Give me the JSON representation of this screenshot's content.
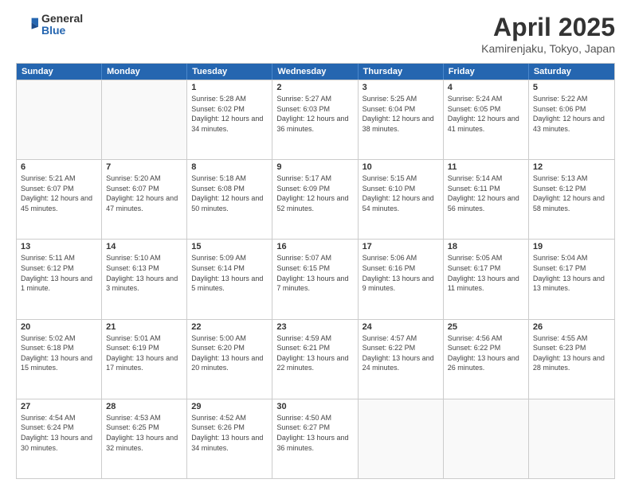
{
  "header": {
    "logo": {
      "general": "General",
      "blue": "Blue"
    },
    "title": "April 2025",
    "location": "Kamirenjaku, Tokyo, Japan"
  },
  "calendar": {
    "days_of_week": [
      "Sunday",
      "Monday",
      "Tuesday",
      "Wednesday",
      "Thursday",
      "Friday",
      "Saturday"
    ],
    "weeks": [
      [
        {
          "day": "",
          "empty": true
        },
        {
          "day": "",
          "empty": true
        },
        {
          "day": "1",
          "sunrise": "5:28 AM",
          "sunset": "6:02 PM",
          "daylight": "12 hours and 34 minutes."
        },
        {
          "day": "2",
          "sunrise": "5:27 AM",
          "sunset": "6:03 PM",
          "daylight": "12 hours and 36 minutes."
        },
        {
          "day": "3",
          "sunrise": "5:25 AM",
          "sunset": "6:04 PM",
          "daylight": "12 hours and 38 minutes."
        },
        {
          "day": "4",
          "sunrise": "5:24 AM",
          "sunset": "6:05 PM",
          "daylight": "12 hours and 41 minutes."
        },
        {
          "day": "5",
          "sunrise": "5:22 AM",
          "sunset": "6:06 PM",
          "daylight": "12 hours and 43 minutes."
        }
      ],
      [
        {
          "day": "6",
          "sunrise": "5:21 AM",
          "sunset": "6:07 PM",
          "daylight": "12 hours and 45 minutes."
        },
        {
          "day": "7",
          "sunrise": "5:20 AM",
          "sunset": "6:07 PM",
          "daylight": "12 hours and 47 minutes."
        },
        {
          "day": "8",
          "sunrise": "5:18 AM",
          "sunset": "6:08 PM",
          "daylight": "12 hours and 50 minutes."
        },
        {
          "day": "9",
          "sunrise": "5:17 AM",
          "sunset": "6:09 PM",
          "daylight": "12 hours and 52 minutes."
        },
        {
          "day": "10",
          "sunrise": "5:15 AM",
          "sunset": "6:10 PM",
          "daylight": "12 hours and 54 minutes."
        },
        {
          "day": "11",
          "sunrise": "5:14 AM",
          "sunset": "6:11 PM",
          "daylight": "12 hours and 56 minutes."
        },
        {
          "day": "12",
          "sunrise": "5:13 AM",
          "sunset": "6:12 PM",
          "daylight": "12 hours and 58 minutes."
        }
      ],
      [
        {
          "day": "13",
          "sunrise": "5:11 AM",
          "sunset": "6:12 PM",
          "daylight": "13 hours and 1 minute."
        },
        {
          "day": "14",
          "sunrise": "5:10 AM",
          "sunset": "6:13 PM",
          "daylight": "13 hours and 3 minutes."
        },
        {
          "day": "15",
          "sunrise": "5:09 AM",
          "sunset": "6:14 PM",
          "daylight": "13 hours and 5 minutes."
        },
        {
          "day": "16",
          "sunrise": "5:07 AM",
          "sunset": "6:15 PM",
          "daylight": "13 hours and 7 minutes."
        },
        {
          "day": "17",
          "sunrise": "5:06 AM",
          "sunset": "6:16 PM",
          "daylight": "13 hours and 9 minutes."
        },
        {
          "day": "18",
          "sunrise": "5:05 AM",
          "sunset": "6:17 PM",
          "daylight": "13 hours and 11 minutes."
        },
        {
          "day": "19",
          "sunrise": "5:04 AM",
          "sunset": "6:17 PM",
          "daylight": "13 hours and 13 minutes."
        }
      ],
      [
        {
          "day": "20",
          "sunrise": "5:02 AM",
          "sunset": "6:18 PM",
          "daylight": "13 hours and 15 minutes."
        },
        {
          "day": "21",
          "sunrise": "5:01 AM",
          "sunset": "6:19 PM",
          "daylight": "13 hours and 17 minutes."
        },
        {
          "day": "22",
          "sunrise": "5:00 AM",
          "sunset": "6:20 PM",
          "daylight": "13 hours and 20 minutes."
        },
        {
          "day": "23",
          "sunrise": "4:59 AM",
          "sunset": "6:21 PM",
          "daylight": "13 hours and 22 minutes."
        },
        {
          "day": "24",
          "sunrise": "4:57 AM",
          "sunset": "6:22 PM",
          "daylight": "13 hours and 24 minutes."
        },
        {
          "day": "25",
          "sunrise": "4:56 AM",
          "sunset": "6:22 PM",
          "daylight": "13 hours and 26 minutes."
        },
        {
          "day": "26",
          "sunrise": "4:55 AM",
          "sunset": "6:23 PM",
          "daylight": "13 hours and 28 minutes."
        }
      ],
      [
        {
          "day": "27",
          "sunrise": "4:54 AM",
          "sunset": "6:24 PM",
          "daylight": "13 hours and 30 minutes."
        },
        {
          "day": "28",
          "sunrise": "4:53 AM",
          "sunset": "6:25 PM",
          "daylight": "13 hours and 32 minutes."
        },
        {
          "day": "29",
          "sunrise": "4:52 AM",
          "sunset": "6:26 PM",
          "daylight": "13 hours and 34 minutes."
        },
        {
          "day": "30",
          "sunrise": "4:50 AM",
          "sunset": "6:27 PM",
          "daylight": "13 hours and 36 minutes."
        },
        {
          "day": "",
          "empty": true
        },
        {
          "day": "",
          "empty": true
        },
        {
          "day": "",
          "empty": true
        }
      ]
    ]
  }
}
